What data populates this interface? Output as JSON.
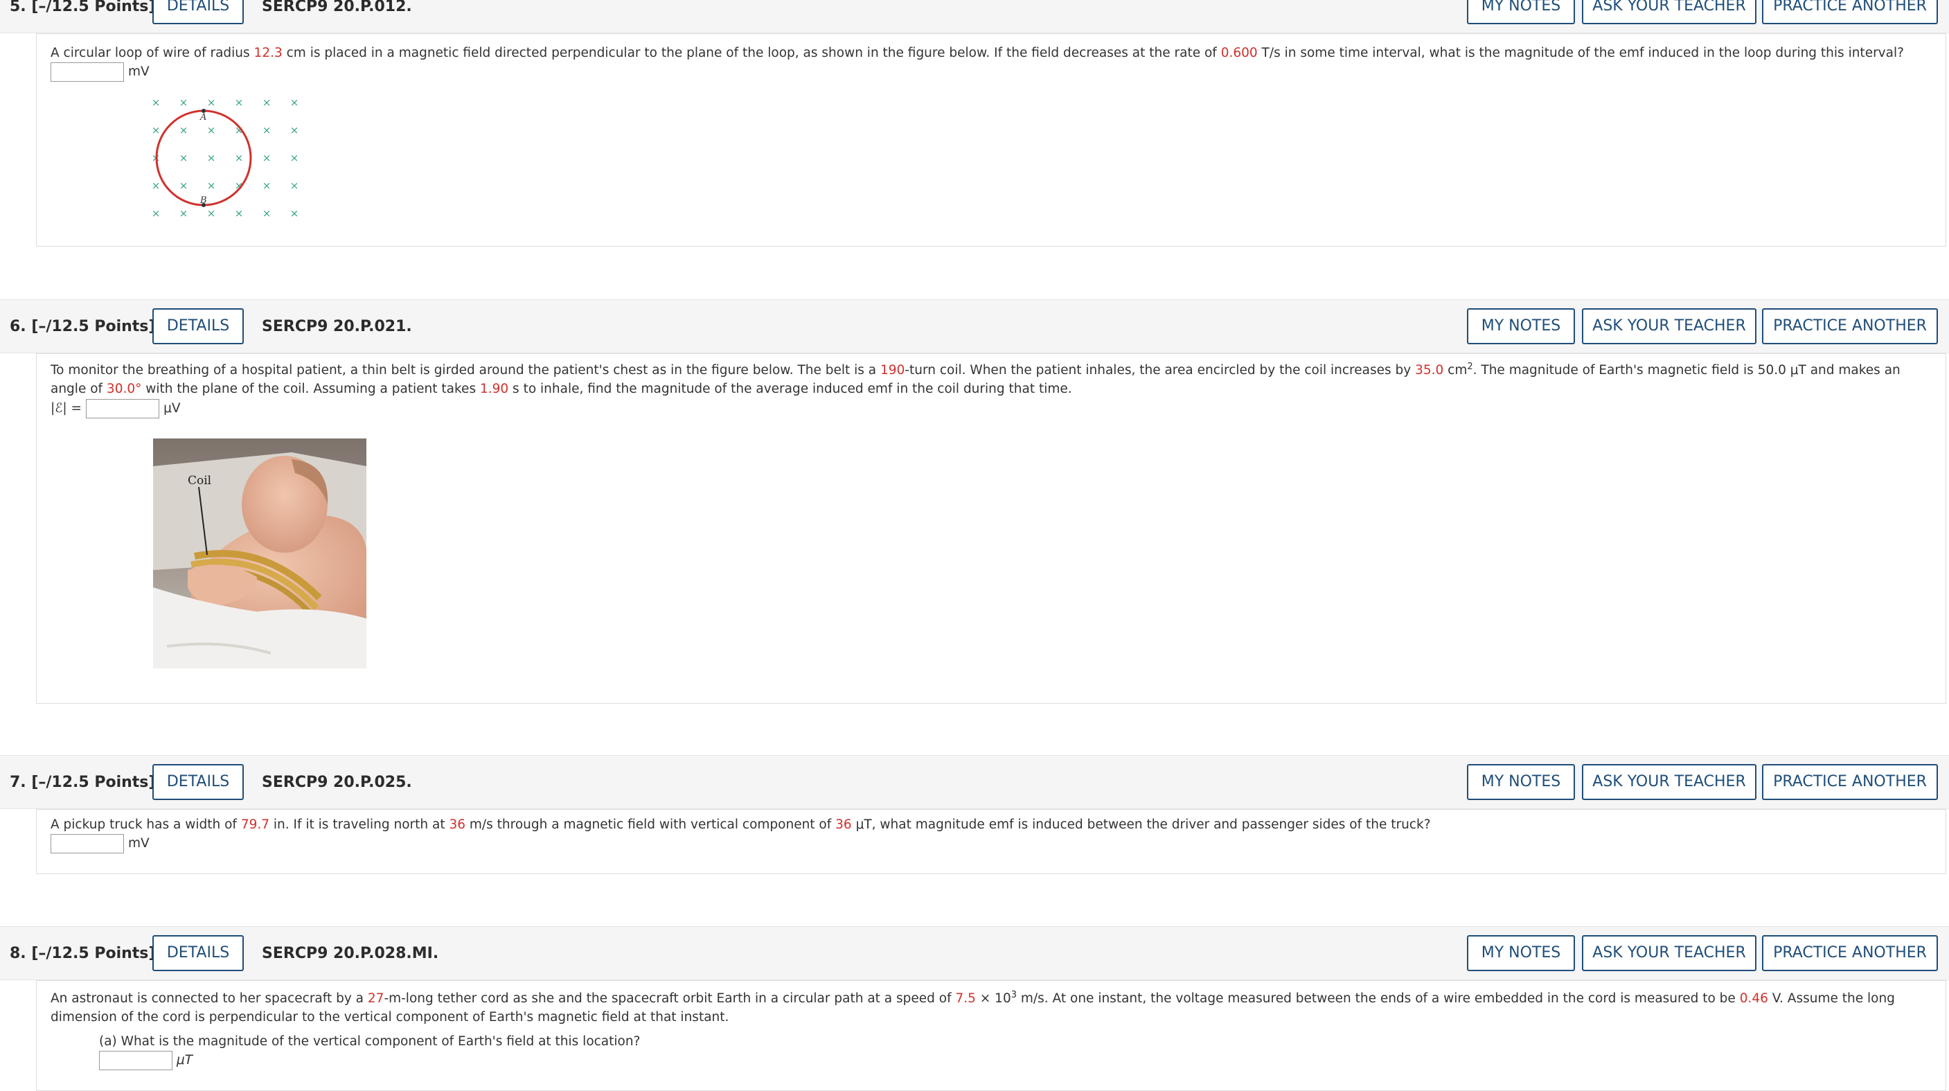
{
  "buttons": {
    "details": "DETAILS",
    "my_notes": "MY NOTES",
    "ask_teacher": "ASK YOUR TEACHER",
    "practice": "PRACTICE ANOTHER"
  },
  "q5": {
    "number": "5.  [–/12.5 Points]",
    "code": "SERCP9 20.P.012.",
    "t1": "A circular loop of wire of radius ",
    "v1": "12.3",
    "t2": " cm is placed in a magnetic field directed perpendicular to the plane of the loop, as shown in the figure below. If the field decreases at the rate of ",
    "v2": "0.600",
    "t3": " T/s in some time interval, what is the magnitude of the emf induced in the loop during this interval?",
    "unit": "mV",
    "figure": {
      "label_a": "A",
      "label_b": "B",
      "loop_color": "#d0312d",
      "field_color": "#3aa38a"
    }
  },
  "q6": {
    "number": "6.  [–/12.5 Points]",
    "code": "SERCP9 20.P.021.",
    "t1": "To monitor the breathing of a hospital patient, a thin belt is girded around the patient's chest as in the figure below. The belt is a ",
    "v1": "190",
    "t2": "-turn coil. When the patient inhales, the area encircled by the coil increases by ",
    "v2": "35.0",
    "t3": " cm",
    "sup": "2",
    "t4": ". The magnitude of Earth's magnetic field is 50.0 μT and makes an angle of ",
    "v3": "30.0°",
    "t5": " with the plane of the coil. Assuming a patient takes ",
    "v4": "1.90",
    "t6": " s to inhale, find the magnitude of the average induced emf in the coil during that time.",
    "prefix": "|ℰ| =",
    "unit": "μV",
    "figure": {
      "label": "Coil"
    }
  },
  "q7": {
    "number": "7.  [–/12.5 Points]",
    "code": "SERCP9 20.P.025.",
    "t1": "A pickup truck has a width of ",
    "v1": "79.7",
    "t2": " in. If it is traveling north at ",
    "v2": "36",
    "t3": " m/s through a magnetic field with vertical component of ",
    "v3": "36",
    "t4": " μT, what magnitude emf is induced between the driver and passenger sides of the truck?",
    "unit": "mV"
  },
  "q8": {
    "number": "8.  [–/12.5 Points]",
    "code": "SERCP9 20.P.028.MI.",
    "t1": "An astronaut is connected to her spacecraft by a ",
    "v1": "27",
    "t2": "-m-long tether cord as she and the spacecraft orbit Earth in a circular path at a speed of ",
    "v2": "7.5",
    "t3": " × 10",
    "sup": "3",
    "t4": " m/s. At one instant, the voltage measured between the ends of a wire embedded in the cord is measured to be ",
    "v3": "0.46",
    "t5": " V. Assume the long dimension of the cord is perpendicular to the vertical component of Earth's magnetic field at that instant.",
    "part_a": "(a) What is the magnitude of the vertical component of Earth's field at this location?",
    "unit": "μT"
  }
}
